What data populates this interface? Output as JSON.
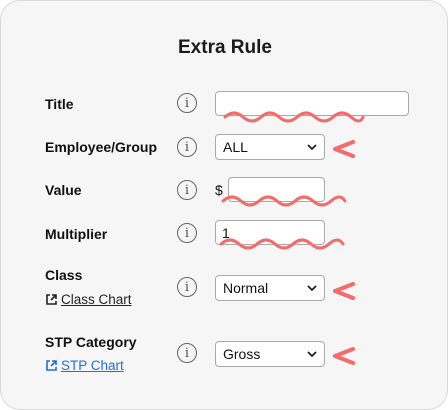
{
  "form": {
    "title": "Extra Rule",
    "fields": {
      "title": {
        "label": "Title",
        "value": "",
        "info": "i"
      },
      "employee_group": {
        "label": "Employee/Group",
        "value": "ALL",
        "info": "i"
      },
      "value": {
        "label": "Value",
        "currency": "$",
        "value": "",
        "info": "i"
      },
      "multiplier": {
        "label": "Multiplier",
        "value": "1",
        "info": "i"
      },
      "class": {
        "label": "Class",
        "link": "Class Chart",
        "value": "Normal",
        "info": "i"
      },
      "stp_category": {
        "label": "STP Category",
        "link": "STP Chart",
        "value": "Gross",
        "info": "i"
      }
    }
  },
  "colors": {
    "annotation": "#f36b6b",
    "link_blue": "#1e6fd9",
    "card_bg": "#f6f6f6"
  }
}
